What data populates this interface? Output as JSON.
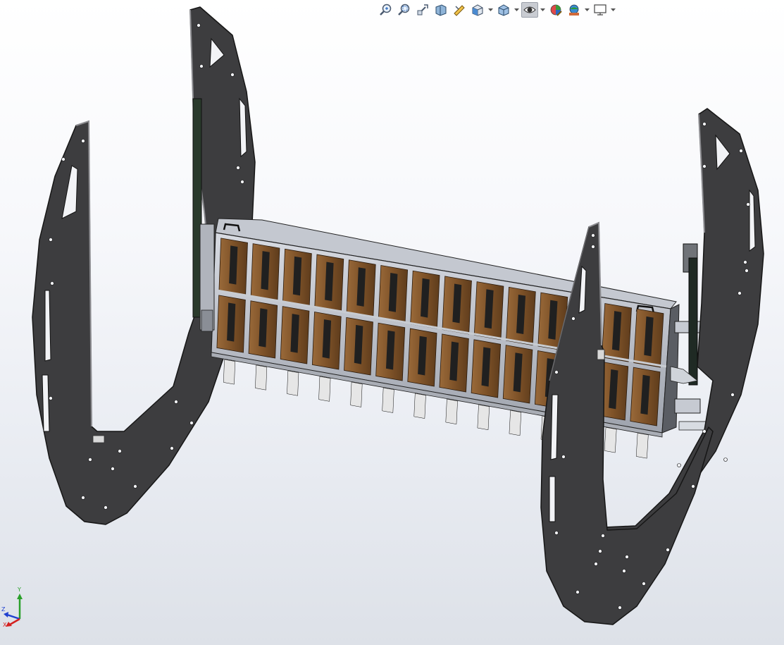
{
  "window": {
    "background_top": "#ffffff",
    "background_bottom": "#dde1e8"
  },
  "toolbar": {
    "items": [
      {
        "icon": "zoom-to-fit-icon",
        "dropdown": false
      },
      {
        "icon": "zoom-to-area-icon",
        "dropdown": false
      },
      {
        "icon": "previous-view-icon",
        "dropdown": false
      },
      {
        "icon": "section-view-icon",
        "dropdown": false
      },
      {
        "icon": "dynamic-annotation-icon",
        "dropdown": false
      },
      {
        "icon": "view-orientation-icon",
        "dropdown": true
      },
      {
        "icon": "display-style-icon",
        "dropdown": true
      },
      {
        "icon": "hide-show-items-icon",
        "dropdown": true,
        "active": true
      },
      {
        "icon": "edit-appearance-icon",
        "dropdown": false
      },
      {
        "icon": "apply-scene-icon",
        "dropdown": true
      },
      {
        "icon": "view-settings-icon",
        "dropdown": true
      }
    ]
  },
  "triad": {
    "x_label": "X",
    "y_label": "Y",
    "z_label": "Z",
    "x_color": "#d42020",
    "y_color": "#2aa02a",
    "z_color": "#2040d0"
  },
  "model": {
    "plate_color": "#3c3c3c",
    "plate_edge_color": "#1a1a1a",
    "module_color": "#8a5a30",
    "frame_color": "#b8bcc4",
    "columns": 14,
    "rows": 2
  }
}
